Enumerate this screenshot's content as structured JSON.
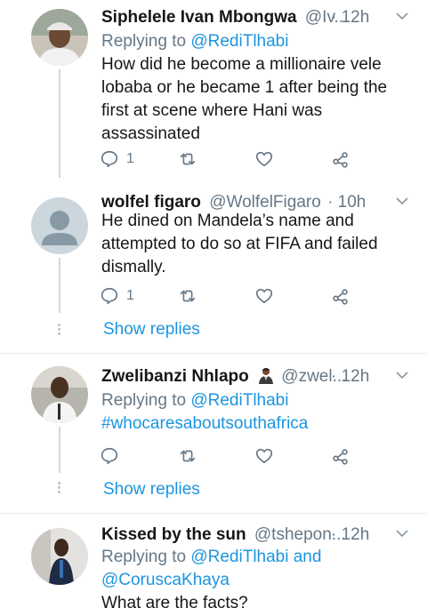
{
  "tweets": [
    {
      "name": "Siphelele Ivan Mbongwa",
      "handle": "@Iv...",
      "time": "· 12h",
      "replying_label": "Replying to",
      "replying_to": "@RediTlhabi",
      "replying_extra": "",
      "text": "How did he become a millionaire vele lobaba or he became 1 after being the first at scene where Hani was assassinated",
      "reply_count": "1",
      "show_replies": ""
    },
    {
      "name": "wolfel figaro",
      "handle": "@WolfelFigaro",
      "time": "· 10h",
      "text": "He dined on Mandela’s name and attempted to do so at FIFA and failed dismally.",
      "reply_count": "1",
      "show_replies": "Show replies"
    },
    {
      "name": "Zwelibanzi Nhlapo",
      "handle": "@zwel...",
      "time": "· 12h",
      "replying_label": "Replying to",
      "replying_to": "@RediTlhabi",
      "text": "#whocaresaboutsouthafrica",
      "reply_count": "",
      "show_replies": "Show replies"
    },
    {
      "name": "Kissed by the sun",
      "handle": "@tshepon...",
      "time": "· 12h",
      "replying_label": "Replying to",
      "replying_to": "@RediTlhabi and",
      "replying_to_2": "@CoruscaKhaya",
      "text": "What are the facts?"
    }
  ],
  "icons": {
    "reply": "reply-icon",
    "retweet": "retweet-icon",
    "like": "heart-icon",
    "share": "share-icon",
    "caret": "chevron-down-icon"
  },
  "colors": {
    "link": "#1b95e0",
    "muted": "#657786",
    "text": "#14171a"
  }
}
